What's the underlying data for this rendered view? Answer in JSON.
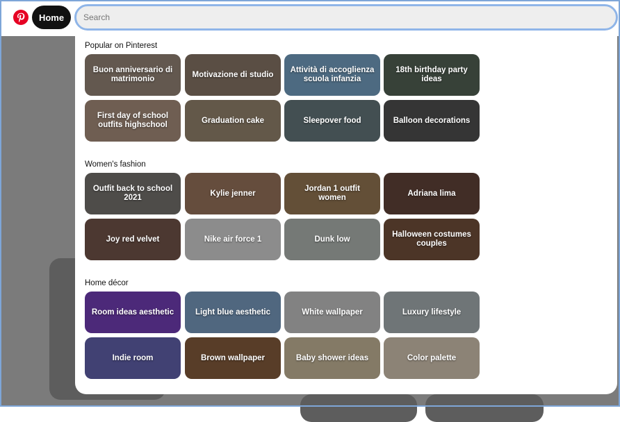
{
  "header": {
    "home_label": "Home",
    "search_placeholder": "Search",
    "search_value": ""
  },
  "sections": [
    {
      "title": "Popular on Pinterest",
      "tiles": [
        {
          "label": "Buon anniversario di matrimonio",
          "color": "#8a7a6e"
        },
        {
          "label": "Motivazione di studio",
          "color": "#7d6d5f"
        },
        {
          "label": "Attività di accoglienza scuola infanzia",
          "color": "#6b93b3"
        },
        {
          "label": "18th birthday party ideas",
          "color": "#4d5a4e"
        },
        {
          "label": "First day of school outfits highschool",
          "color": "#9a8372"
        },
        {
          "label": "Graduation cake",
          "color": "#8a7a66"
        },
        {
          "label": "Sleepover food",
          "color": "#5e6e72"
        },
        {
          "label": "Balloon decorations",
          "color": "#4a4a4a"
        }
      ]
    },
    {
      "title": "Women's fashion",
      "tiles": [
        {
          "label": "Outfit back to school 2021",
          "color": "#6c6a66"
        },
        {
          "label": "Kylie jenner",
          "color": "#8c6b55"
        },
        {
          "label": "Jordan 1 outfit women",
          "color": "#8a6e4d"
        },
        {
          "label": "Adriana lima",
          "color": "#5b3f35"
        },
        {
          "label": "Joy red velvet",
          "color": "#6a4e45"
        },
        {
          "label": "Nike air force 1",
          "color": "#c2c2c2"
        },
        {
          "label": "Dunk low",
          "color": "#a3a8a4"
        },
        {
          "label": "Halloween costumes couples",
          "color": "#6a4a36"
        }
      ]
    },
    {
      "title": "Home décor",
      "tiles": [
        {
          "label": "Room ideas aesthetic",
          "color": "#6a3aa8"
        },
        {
          "label": "Light blue aesthetic",
          "color": "#6f8fb0"
        },
        {
          "label": "White wallpaper",
          "color": "#b4b4b4"
        },
        {
          "label": "Luxury lifestyle",
          "color": "#9aa2a6"
        },
        {
          "label": "Indie room",
          "color": "#5a5aa0"
        },
        {
          "label": "Brown wallpaper",
          "color": "#7a5538"
        },
        {
          "label": "Baby shower ideas",
          "color": "#b8a98e"
        },
        {
          "label": "Color palette",
          "color": "#c3b6a4"
        }
      ]
    }
  ]
}
